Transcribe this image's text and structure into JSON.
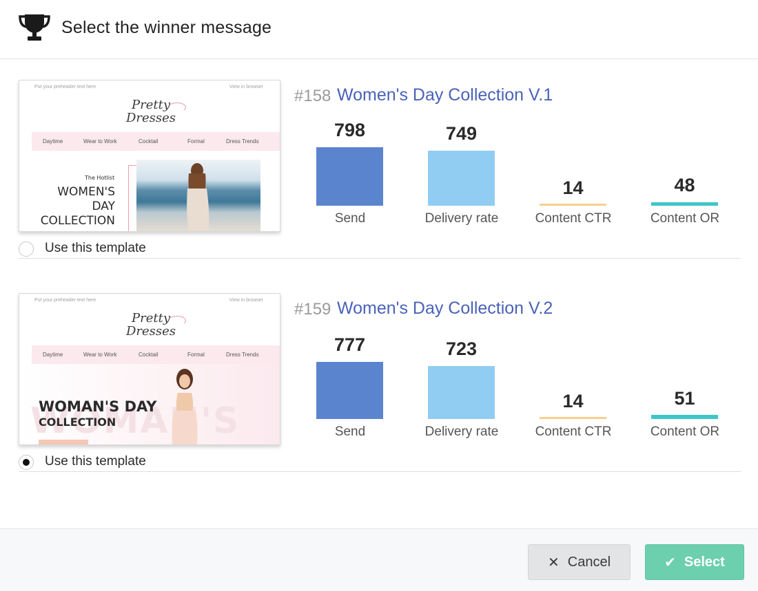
{
  "header": {
    "title": "Select the winner message",
    "icon": "trophy-icon"
  },
  "thumb_common": {
    "preheader": "Put your preheader text here",
    "view_browser": "View in browser",
    "logo_line1": "Pretty",
    "logo_line2": "Dresses",
    "nav": [
      "Daytime",
      "Wear to Work",
      "Cocktail",
      "Formal",
      "Dress Trends"
    ]
  },
  "variants": [
    {
      "id": "#158",
      "name": "Women's Day Collection V.1",
      "hero": {
        "kicker": "The Hotlist",
        "line1": "WOMEN'S",
        "line2": "DAY",
        "line3": "COLLECTION"
      },
      "metrics": [
        {
          "label": "Send",
          "value": "798",
          "color": "#5b84cf"
        },
        {
          "label": "Delivery rate",
          "value": "749",
          "color": "#91cdf2"
        },
        {
          "label": "Content CTR",
          "value": "14",
          "color": "#f7cf8a"
        },
        {
          "label": "Content OR",
          "value": "48",
          "color": "#3cc6c9"
        }
      ],
      "radio_label": "Use this template",
      "selected": false
    },
    {
      "id": "#159",
      "name": "Women's Day Collection V.2",
      "hero": {
        "line1": "WOMAN'S DAY",
        "line2": "COLLECTION",
        "bg_word": "WOMAN'S"
      },
      "metrics": [
        {
          "label": "Send",
          "value": "777",
          "color": "#5b84cf"
        },
        {
          "label": "Delivery rate",
          "value": "723",
          "color": "#91cdf2"
        },
        {
          "label": "Content CTR",
          "value": "14",
          "color": "#f7cf8a"
        },
        {
          "label": "Content OR",
          "value": "51",
          "color": "#3cc6c9"
        }
      ],
      "radio_label": "Use this template",
      "selected": true
    }
  ],
  "footer": {
    "cancel_label": "Cancel",
    "select_label": "Select"
  }
}
